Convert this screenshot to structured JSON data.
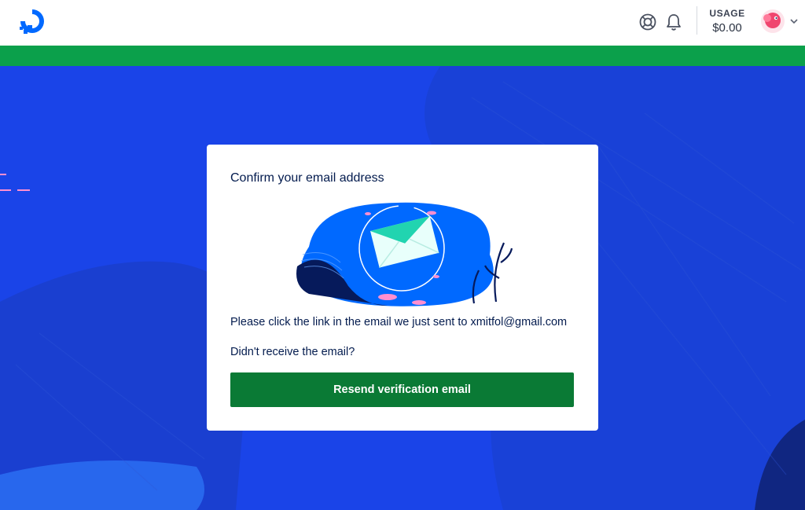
{
  "header": {
    "logo_icon": "digitalocean-logo-icon",
    "help_icon": "lifebuoy-icon",
    "notifications_icon": "bell-icon",
    "usage_label": "USAGE",
    "usage_value": "$0.00",
    "avatar_icon": "user-avatar-icon",
    "menu_icon": "chevron-down-icon"
  },
  "banner": {
    "color": "#0ba04b"
  },
  "card": {
    "title": "Confirm your email address",
    "illustration_icon": "envelope-illustration",
    "message": "Please click the link in the email we just sent to xmitfol@gmail.com",
    "prompt": "Didn't receive the email?",
    "resend_button": "Resend verification email"
  },
  "colors": {
    "brand_blue": "#0069ff",
    "background_blue": "#1a44e8",
    "button_green": "#0a7a35",
    "text_navy": "#031b4e"
  }
}
